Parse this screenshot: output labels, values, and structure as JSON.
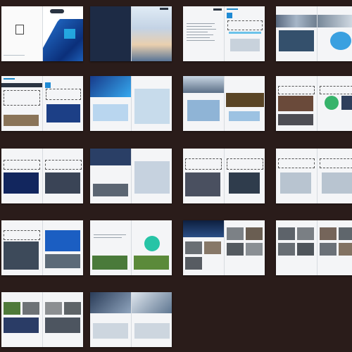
{
  "sheet": {
    "background": "#2a1c1a",
    "rows": 5,
    "columns": 4,
    "spread_count": 18
  },
  "colors": {
    "accent_blue": "#1f8ad4",
    "page": "#f4f5f7",
    "dark_text": "#2a3442"
  }
}
